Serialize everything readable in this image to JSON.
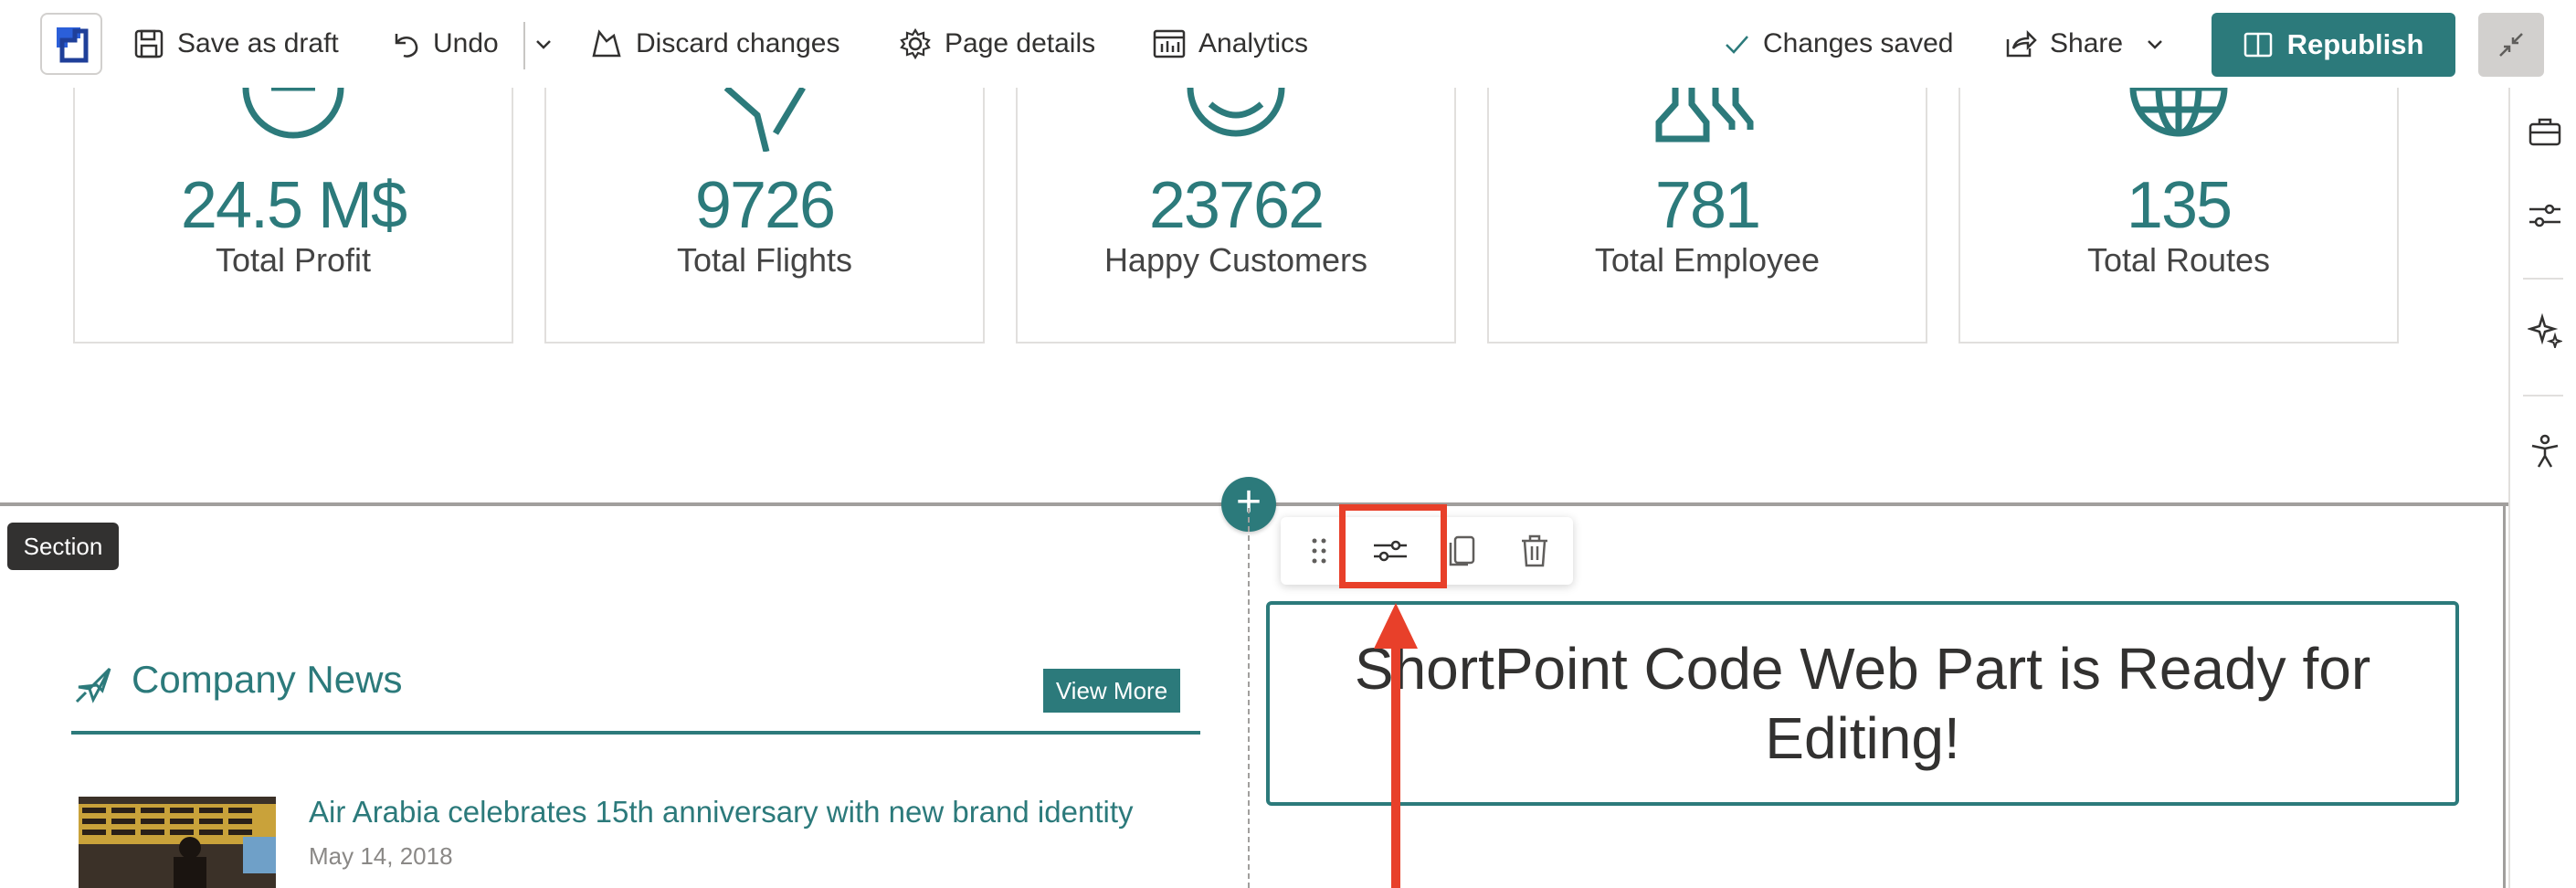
{
  "toolbar": {
    "save_draft": "Save as draft",
    "undo": "Undo",
    "discard": "Discard changes",
    "page_details": "Page details",
    "analytics": "Analytics",
    "status": "Changes saved",
    "share": "Share",
    "republish": "Republish"
  },
  "stats": [
    {
      "value": "24.5 M$",
      "label": "Total Profit",
      "icon": "dial-icon"
    },
    {
      "value": "9726",
      "label": "Total Flights",
      "icon": "plane-icon"
    },
    {
      "value": "23762",
      "label": "Happy Customers",
      "icon": "smiley-icon"
    },
    {
      "value": "781",
      "label": "Total Employee",
      "icon": "people-icon"
    },
    {
      "value": "135",
      "label": "Total Routes",
      "icon": "globe-icon"
    }
  ],
  "section": {
    "badge": "Section"
  },
  "news": {
    "title": "Company News",
    "view_more": "View More",
    "items": [
      {
        "headline": "Air Arabia celebrates 15th anniversary with new brand identity",
        "date": "May 14, 2018"
      }
    ]
  },
  "webpart": {
    "text": "ShortPoint Code Web Part is Ready for Editing!"
  },
  "colors": {
    "accent": "#2c7a7b",
    "highlight": "#e8402a"
  }
}
